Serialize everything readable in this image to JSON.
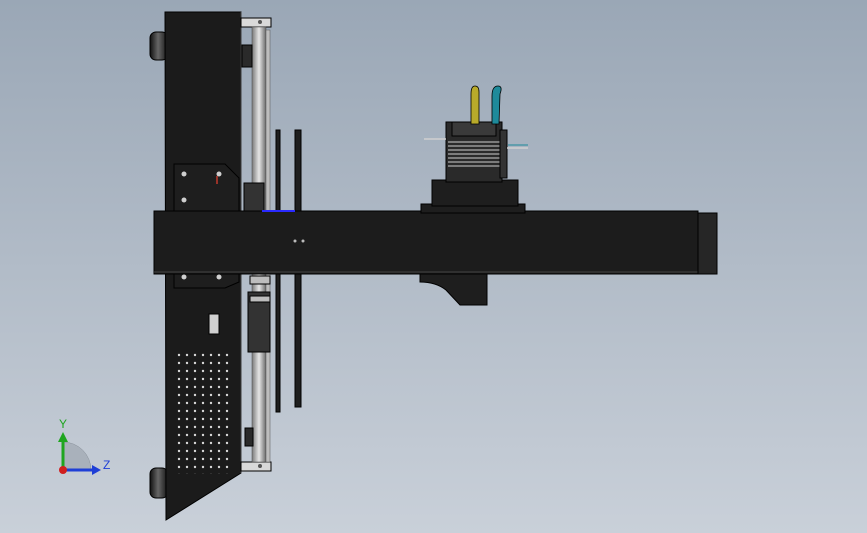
{
  "viewport": {
    "background_top": "#9aa7b6",
    "background_bottom": "#c9d0d9"
  },
  "model": {
    "body_color": "#1e1e1e",
    "edge_color": "#000000",
    "rail_color": "#c8c8c8",
    "highlight_color": "#2a2aff",
    "wire_yellow": "#b8aa2a",
    "wire_teal": "#1e8a9a"
  },
  "triad": {
    "y_label": "Y",
    "z_label": "Z",
    "y_color": "#1fa51f",
    "z_color": "#1f3fd6",
    "x_color": "#d01f1f"
  }
}
